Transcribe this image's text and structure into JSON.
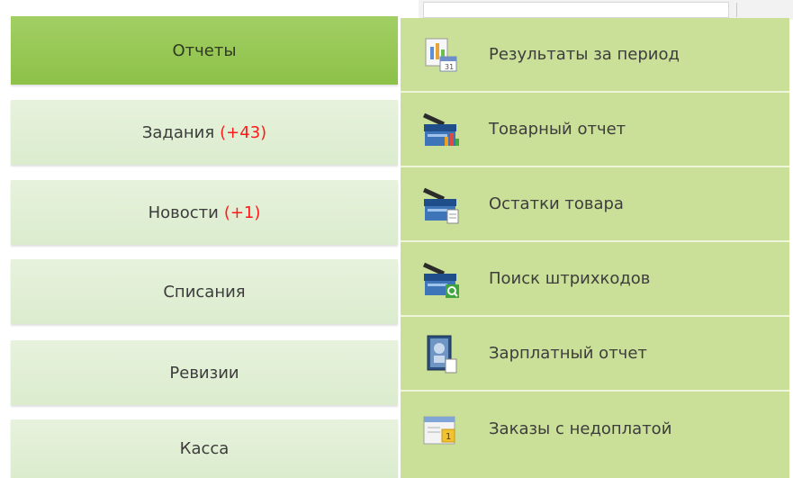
{
  "main_menu": [
    {
      "label": "Отчеты",
      "badge": "",
      "active": true
    },
    {
      "label": "Задания",
      "badge": "(+43)",
      "active": false
    },
    {
      "label": "Новости",
      "badge": "(+1)",
      "active": false
    },
    {
      "label": "Списания",
      "badge": "",
      "active": false
    },
    {
      "label": "Ревизии",
      "badge": "",
      "active": false
    },
    {
      "label": "Касса",
      "badge": "",
      "active": false
    }
  ],
  "reports_submenu": [
    {
      "label": "Результаты за период",
      "icon": "calendar-report-icon"
    },
    {
      "label": "Товарный отчет",
      "icon": "cash-register-chart-icon"
    },
    {
      "label": "Остатки товара",
      "icon": "cash-register-document-icon"
    },
    {
      "label": "Поиск штрихкодов",
      "icon": "cash-register-search-icon"
    },
    {
      "label": "Зарплатный отчет",
      "icon": "payroll-book-icon"
    },
    {
      "label": "Заказы с недоплатой",
      "icon": "underpaid-orders-icon"
    }
  ],
  "colors": {
    "active_menu": "#8dc148",
    "menu_item": "#dbeccd",
    "submenu_bg": "#cadf98",
    "badge": "#ff1a1a"
  }
}
